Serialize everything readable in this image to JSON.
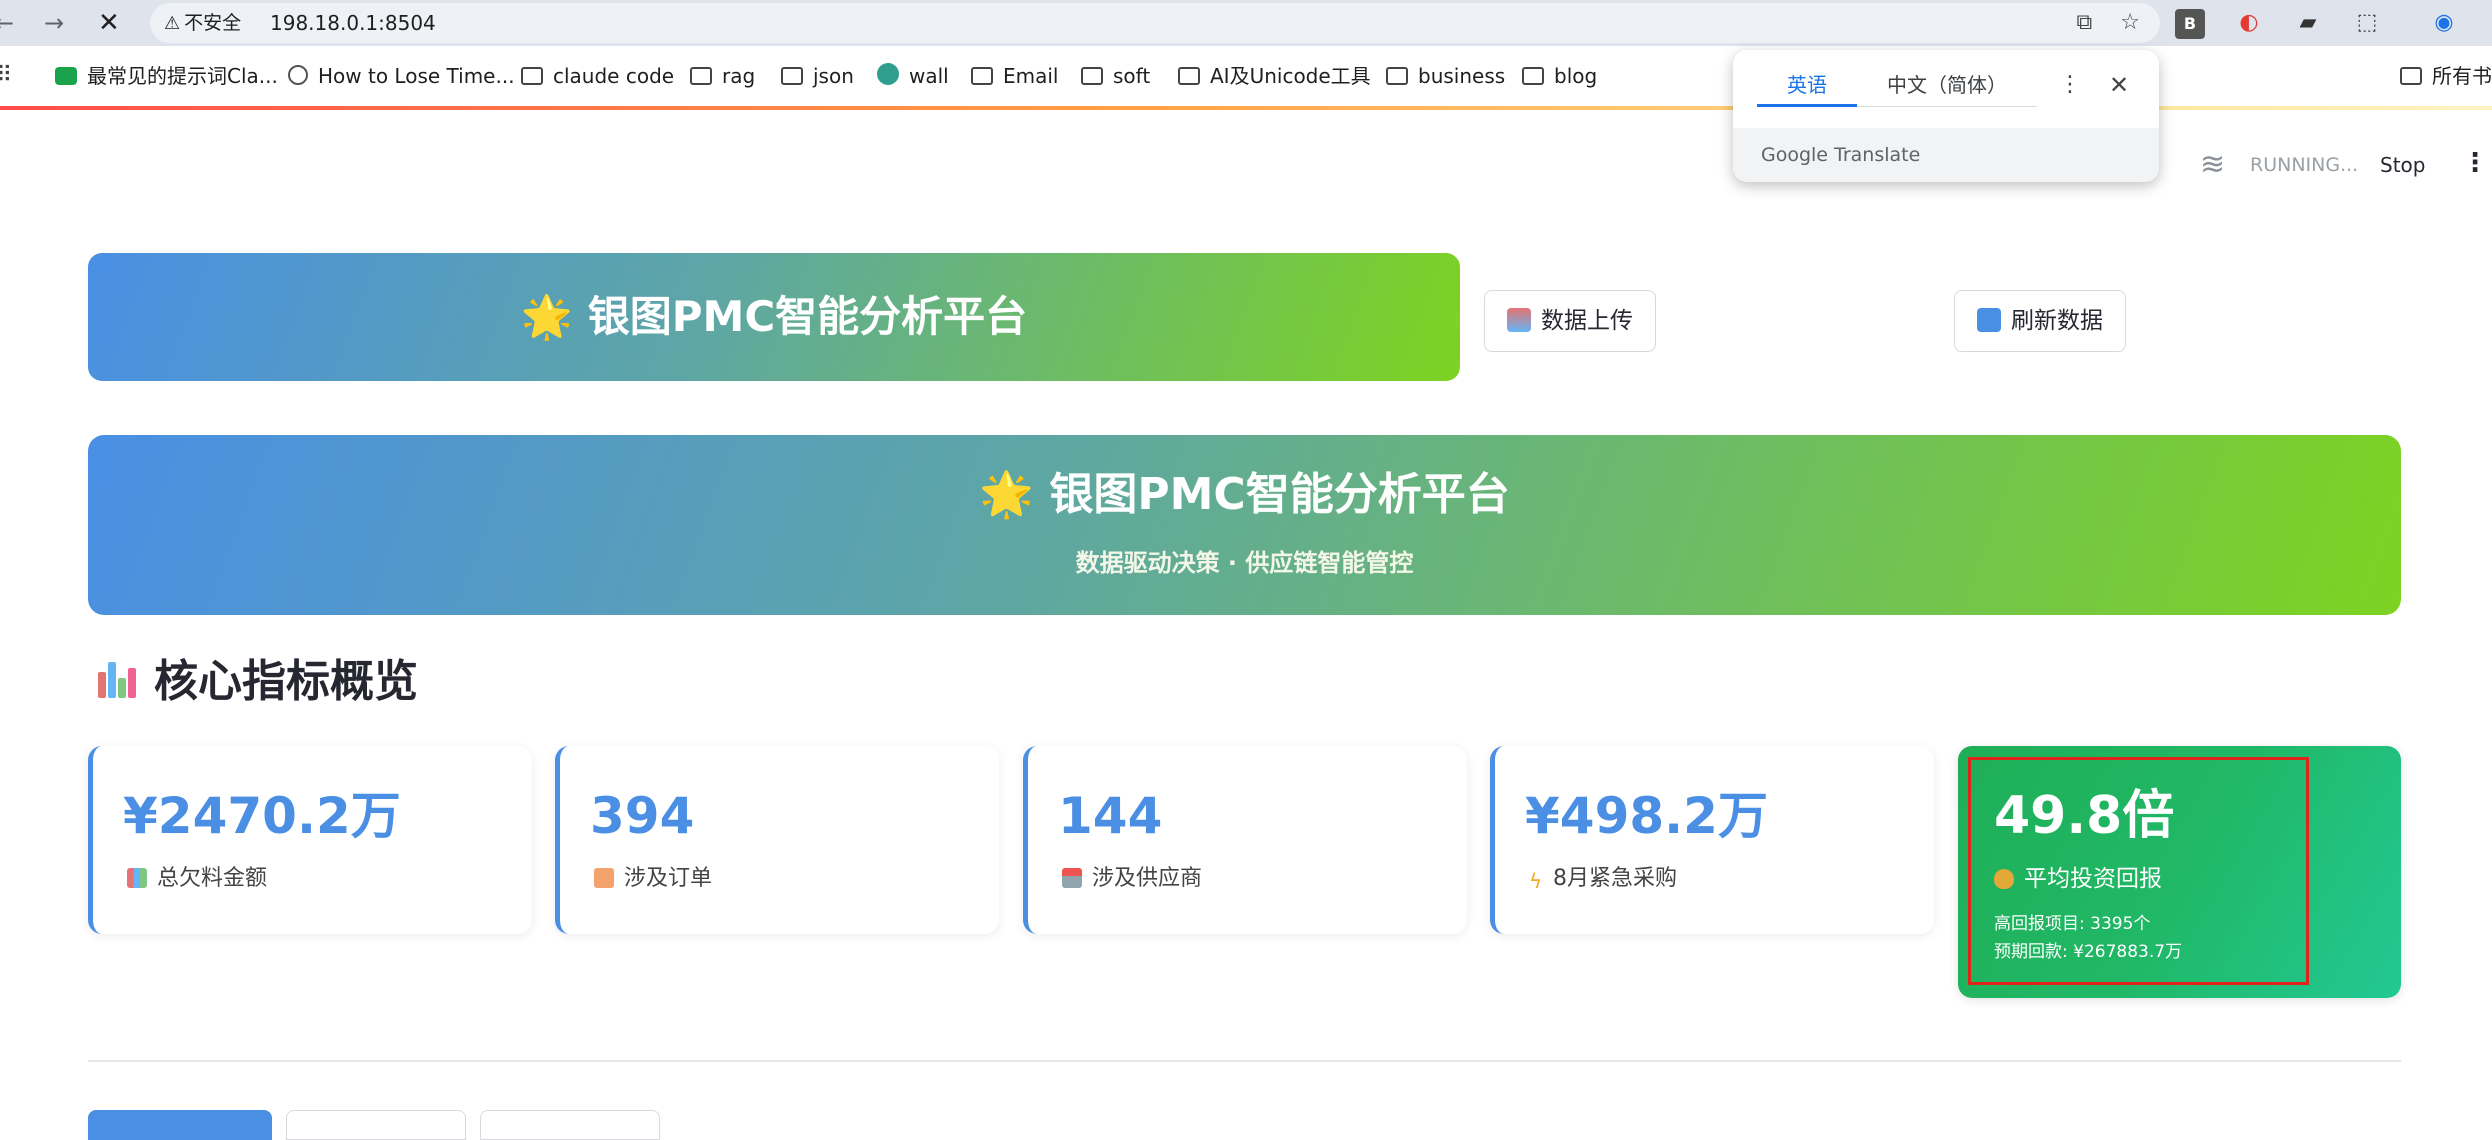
{
  "browser": {
    "insecure_label": "不安全",
    "url": "198.18.0.1:8504",
    "bookmarks": [
      {
        "label": "最常见的提示词Cla...",
        "icon": "evernote-icon"
      },
      {
        "label": "How to Lose Time...",
        "icon": "globe-icon"
      },
      {
        "label": "claude code",
        "icon": "folder-icon"
      },
      {
        "label": "rag",
        "icon": "folder-icon"
      },
      {
        "label": "json",
        "icon": "folder-icon"
      },
      {
        "label": "wall",
        "icon": "wall-icon"
      },
      {
        "label": "Email",
        "icon": "folder-icon"
      },
      {
        "label": "soft",
        "icon": "folder-icon"
      },
      {
        "label": "AI及Unicode工具",
        "icon": "folder-icon"
      },
      {
        "label": "business",
        "icon": "folder-icon"
      },
      {
        "label": "blog",
        "icon": "folder-icon"
      },
      {
        "label": "所有书",
        "icon": "folder-icon"
      }
    ],
    "ext_b": "B"
  },
  "translate_popup": {
    "tab_source": "英语",
    "tab_target": "中文（简体）",
    "brand": "Google Translate"
  },
  "streamlit": {
    "status": "RUNNING...",
    "stop_label": "Stop"
  },
  "app": {
    "header_title": "🌟 银图PMC智能分析平台",
    "upload_button": "数据上传",
    "refresh_button": "刷新数据",
    "banner_title": "🌟 银图PMC智能分析平台",
    "banner_subtitle": "数据驱动决策 · 供应链智能管控",
    "section_title": "核心指标概览",
    "metrics": [
      {
        "value": "¥2470.2万",
        "label": "总欠料金额",
        "icon": "bar-chart-icon"
      },
      {
        "value": "394",
        "label": "涉及订单",
        "icon": "clipboard-icon"
      },
      {
        "value": "144",
        "label": "涉及供应商",
        "icon": "factory-icon"
      },
      {
        "value": "¥498.2万",
        "label": "8月紧急采购",
        "icon": "lightning-icon"
      }
    ],
    "roi_card": {
      "value": "49.8倍",
      "label": "平均投资回报",
      "icon": "money-bag-icon",
      "line1": "高回报项目: 3395个",
      "line2": "预期回款: ¥267883.7万"
    }
  },
  "colors": {
    "accent": "#4a8fe4",
    "green": "#1fae57",
    "highlight_box": "#e0241c"
  }
}
